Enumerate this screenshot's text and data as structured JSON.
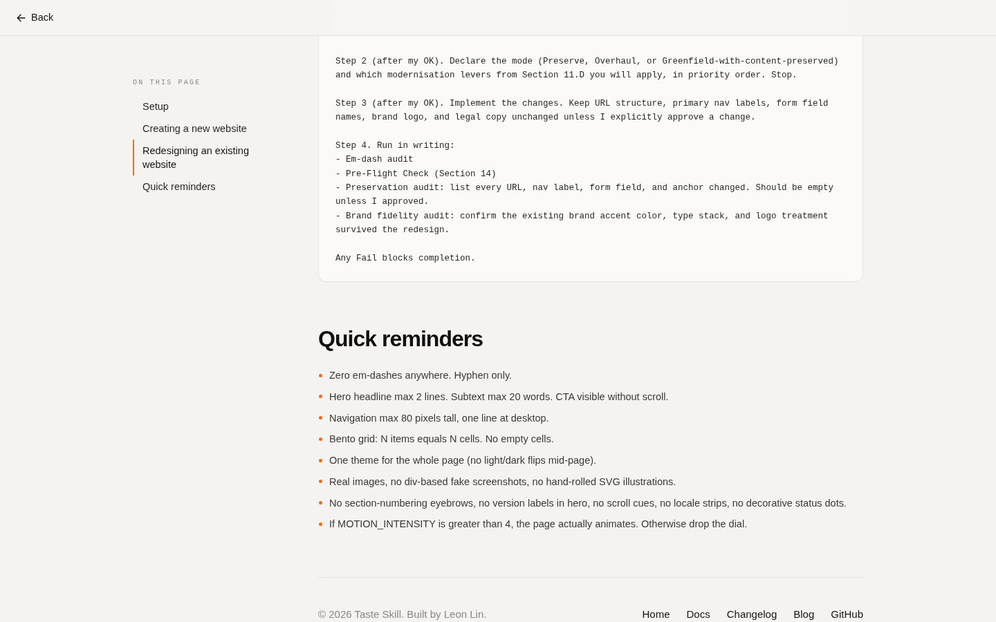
{
  "header": {
    "back_label": "Back"
  },
  "sidebar": {
    "heading": "ON THIS PAGE",
    "items": [
      {
        "label": "Setup",
        "selected": false
      },
      {
        "label": "Creating a new website",
        "selected": false
      },
      {
        "label": "Redesigning an existing website",
        "selected": true
      },
      {
        "label": "Quick reminders",
        "selected": false
      }
    ]
  },
  "code_block": {
    "text": "Step 2 (after my OK). Declare the mode (Preserve, Overhaul, or Greenfield-with-content-preserved) and which modernisation levers from Section 11.D you will apply, in priority order. Stop.\n\nStep 3 (after my OK). Implement the changes. Keep URL structure, primary nav labels, form field names, brand logo, and legal copy unchanged unless I explicitly approve a change.\n\nStep 4. Run in writing:\n- Em-dash audit\n- Pre-Flight Check (Section 14)\n- Preservation audit: list every URL, nav label, form field, and anchor changed. Should be empty unless I approved.\n- Brand fidelity audit: confirm the existing brand accent color, type stack, and logo treatment survived the redesign.\n\nAny Fail blocks completion."
  },
  "section": {
    "title": "Quick reminders",
    "items": [
      "Zero em-dashes anywhere. Hyphen only.",
      "Hero headline max 2 lines. Subtext max 20 words. CTA visible without scroll.",
      "Navigation max 80 pixels tall, one line at desktop.",
      "Bento grid: N items equals N cells. No empty cells.",
      "One theme for the whole page (no light/dark flips mid-page).",
      "Real images, no div-based fake screenshots, no hand-rolled SVG illustrations.",
      "No section-numbering eyebrows, no version labels in hero, no scroll cues, no locale strips, no decorative status dots.",
      "If MOTION_INTENSITY is greater than 4, the page actually animates. Otherwise drop the dial."
    ]
  },
  "footer": {
    "copyright": "© 2026 Taste Skill. Built by Leon Lin.",
    "links": [
      "Home",
      "Docs",
      "Changelog",
      "Blog",
      "GitHub"
    ]
  }
}
